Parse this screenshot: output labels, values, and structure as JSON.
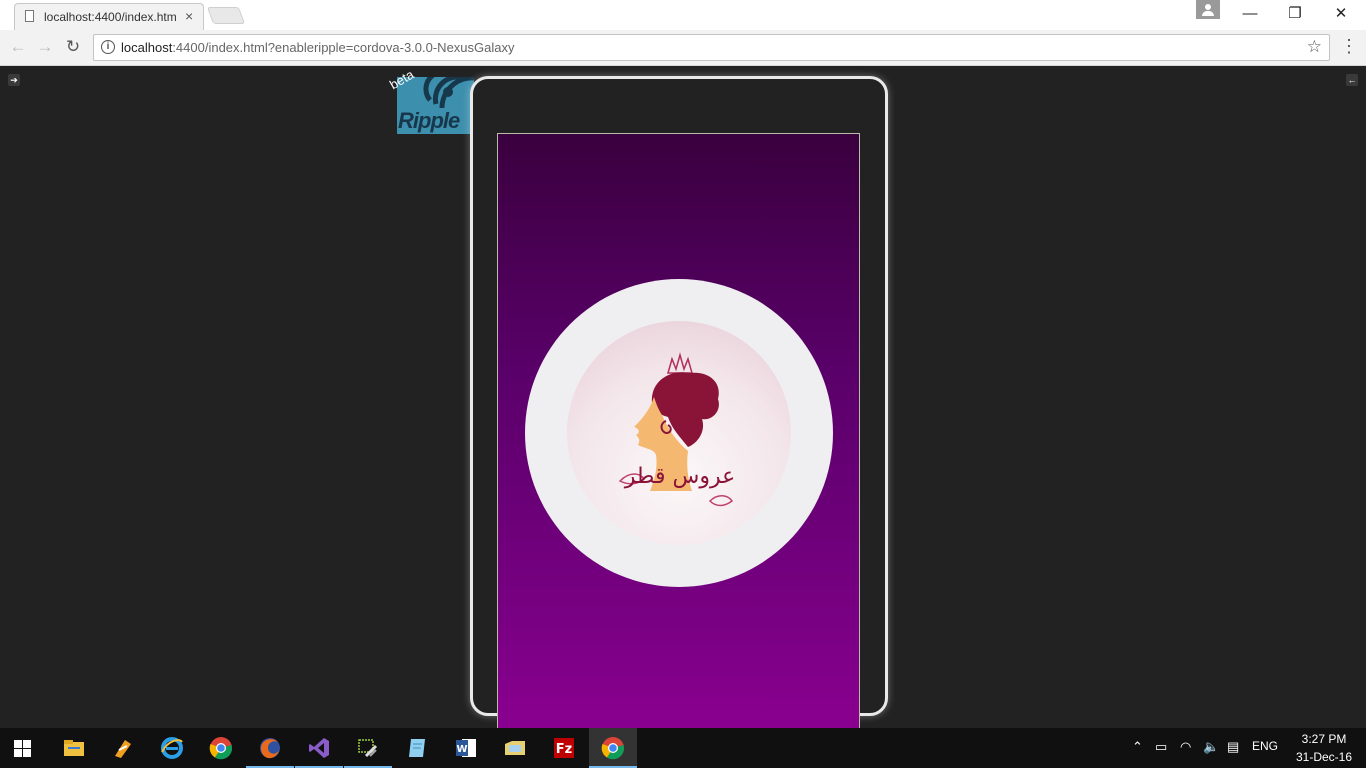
{
  "browser": {
    "tab_title": "localhost:4400/index.htm",
    "tab_close": "×",
    "url_host": "localhost",
    "url_rest": ":4400/index.html?enableripple=cordova-3.0.0-NexusGalaxy",
    "info_glyph": "i",
    "star_glyph": "☆",
    "menu_glyph": "⋮",
    "back_glyph": "←",
    "forward_glyph": "→",
    "reload_glyph": "↻",
    "minimize_glyph": "—",
    "restore_glyph": "❐",
    "close_glyph": "✕"
  },
  "ripple": {
    "logo_text": "Ripple",
    "beta_label": "beta",
    "left_panel_glyph": "➔",
    "right_panel_glyph": "←"
  },
  "app": {
    "emblem_arabic": "عروس قطر",
    "screen_colors": [
      "#3a003e",
      "#8a0090"
    ]
  },
  "taskbar": {
    "items": [
      "start-icon",
      "file-explorer-icon",
      "tool-icon",
      "internet-explorer-icon",
      "chrome-icon",
      "firefox-icon",
      "visual-studio-icon",
      "settings-tool-icon",
      "notes-icon",
      "word-icon",
      "folder-icon",
      "filezilla-icon",
      "chrome-active-icon"
    ],
    "language": "ENG",
    "time": "3:27 PM",
    "date": "31-Dec-16"
  }
}
